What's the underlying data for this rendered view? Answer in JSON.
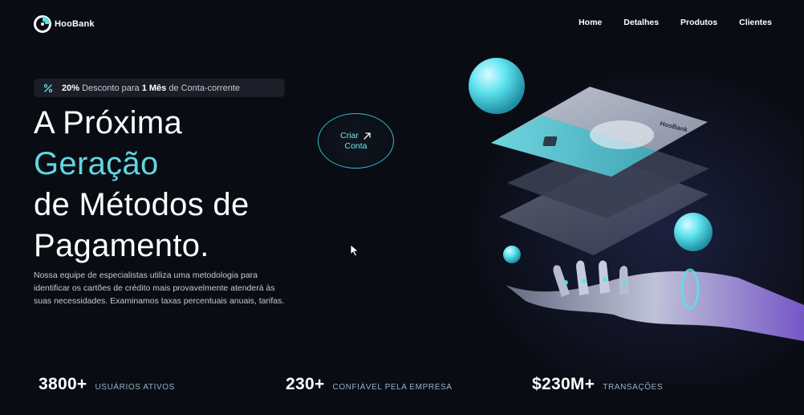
{
  "brand": {
    "name": "HooBank",
    "accent": "#5ce1e6"
  },
  "nav": {
    "items": [
      {
        "label": "Home"
      },
      {
        "label": "Detalhes"
      },
      {
        "label": "Produtos"
      },
      {
        "label": "Clientes"
      }
    ]
  },
  "badge": {
    "icon": "discount-icon",
    "percent": "20%",
    "text_a": " Desconto para ",
    "period": "1 Mês",
    "text_b": " de Conta-corrente"
  },
  "hero": {
    "line1": "A Próxima",
    "line2": "Geração",
    "line3": "de Métodos de",
    "line4": "Pagamento.",
    "description": "Nossa equipe de especialistas utiliza uma metodologia para identificar os cartões de crédito mais provavelmente atenderá às suas necessidades. Examinamos taxas percentuais anuais, tarifas."
  },
  "cta": {
    "line1": "Criar",
    "line2": "Conta",
    "icon": "arrow-up-right-icon"
  },
  "stats": [
    {
      "value": "3800+",
      "label": "Usuários Ativos"
    },
    {
      "value": "230+",
      "label": "Confiável pela Empresa"
    },
    {
      "value": "$230M+",
      "label": "Transações"
    }
  ],
  "card": {
    "brand": "HooBank"
  }
}
